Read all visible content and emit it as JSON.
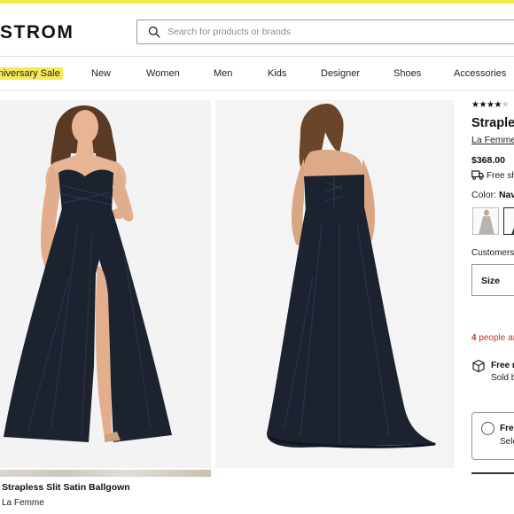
{
  "header": {
    "logo": "STROM",
    "search": {
      "placeholder": "Search for products or brands"
    }
  },
  "nav": {
    "items": [
      "niversary Sale",
      "New",
      "Women",
      "Men",
      "Kids",
      "Designer",
      "Shoes",
      "Accessories"
    ]
  },
  "gallery": {
    "caption_title": "Strapless Slit Satin Ballgown",
    "caption_brand": "La Femme"
  },
  "product": {
    "rating": {
      "stars_filled": 4,
      "stars_total": 5
    },
    "title": "Strapless",
    "brand": "La Femme",
    "price": "$368.00",
    "shipping": "Free sh",
    "color_label": "Color: ",
    "color_value": "Nav",
    "customers_text": "Customers",
    "size_label": "Size",
    "people_count": "4",
    "people_text": " people ar",
    "free_title": "Free r",
    "free_sub": "Sold b",
    "pickup_title": "Free",
    "pickup_sub": "Sele"
  },
  "colors": {
    "accent": "#f7e84a",
    "dress": "#1c2230",
    "urgency": "#b63a2b"
  }
}
